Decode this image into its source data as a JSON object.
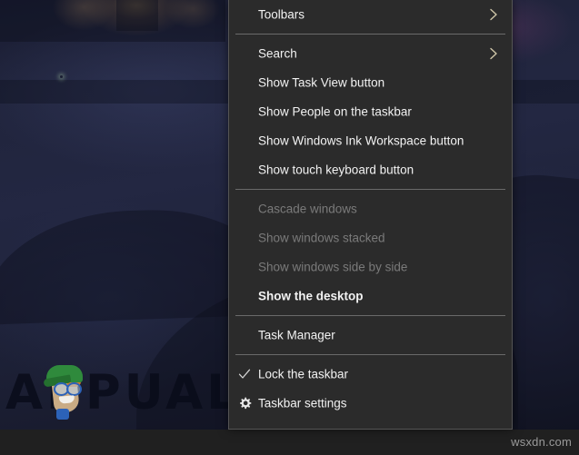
{
  "desktop": {
    "watermark_text": "APPUALS",
    "mascot_icon": "appuals-mascot-icon",
    "site_watermark": "wsxdn.com"
  },
  "context_menu": {
    "name": "taskbar-context-menu",
    "background_color": "#2b2b2b",
    "border_color": "#545454",
    "text_color": "#f2f2f2",
    "disabled_text_color": "#7a7a7a",
    "groups": [
      {
        "items": [
          {
            "label": "Toolbars",
            "has_submenu": true,
            "disabled": false,
            "icon": null,
            "bold": false
          }
        ]
      },
      {
        "items": [
          {
            "label": "Search",
            "has_submenu": true,
            "disabled": false,
            "icon": null,
            "bold": false
          },
          {
            "label": "Show Task View button",
            "has_submenu": false,
            "disabled": false,
            "icon": null,
            "bold": false
          },
          {
            "label": "Show People on the taskbar",
            "has_submenu": false,
            "disabled": false,
            "icon": null,
            "bold": false
          },
          {
            "label": "Show Windows Ink Workspace button",
            "has_submenu": false,
            "disabled": false,
            "icon": null,
            "bold": false
          },
          {
            "label": "Show touch keyboard button",
            "has_submenu": false,
            "disabled": false,
            "icon": null,
            "bold": false
          }
        ]
      },
      {
        "items": [
          {
            "label": "Cascade windows",
            "has_submenu": false,
            "disabled": true,
            "icon": null,
            "bold": false
          },
          {
            "label": "Show windows stacked",
            "has_submenu": false,
            "disabled": true,
            "icon": null,
            "bold": false
          },
          {
            "label": "Show windows side by side",
            "has_submenu": false,
            "disabled": true,
            "icon": null,
            "bold": false
          },
          {
            "label": "Show the desktop",
            "has_submenu": false,
            "disabled": false,
            "icon": null,
            "bold": true
          }
        ]
      },
      {
        "items": [
          {
            "label": "Task Manager",
            "has_submenu": false,
            "disabled": false,
            "icon": null,
            "bold": false
          }
        ]
      },
      {
        "items": [
          {
            "label": "Lock the taskbar",
            "has_submenu": false,
            "disabled": false,
            "icon": "checkmark-icon",
            "bold": false
          },
          {
            "label": "Taskbar settings",
            "has_submenu": false,
            "disabled": false,
            "icon": "gear-icon",
            "bold": false
          }
        ]
      }
    ]
  }
}
